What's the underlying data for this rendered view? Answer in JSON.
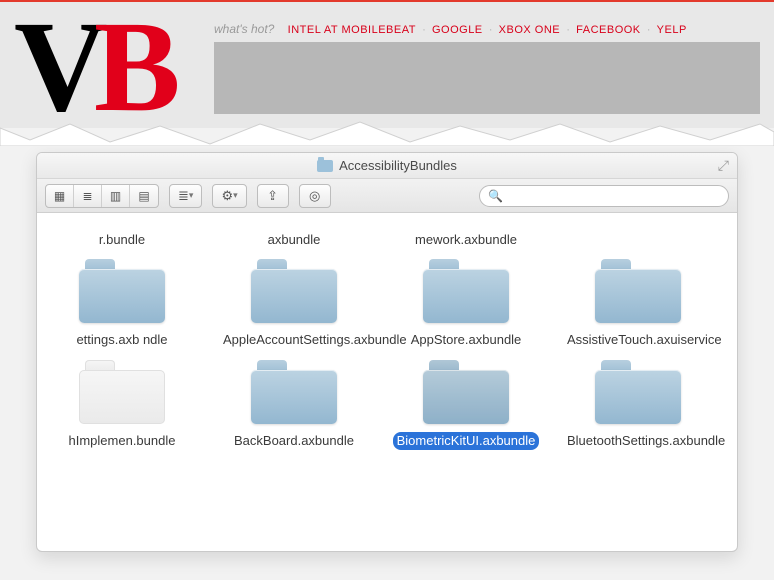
{
  "header": {
    "logo_left": "V",
    "logo_right": "B",
    "lead": "what's hot?",
    "links": [
      "INTEL AT MOBILEBEAT",
      "GOOGLE",
      "XBOX ONE",
      "FACEBOOK",
      "YELP"
    ]
  },
  "finder": {
    "title": "AccessibilityBundles",
    "search_placeholder": "",
    "toolbar": {
      "view_icons": [
        "ico-grid",
        "ico-list",
        "ico-col",
        "ico-cov"
      ]
    },
    "rows": [
      {
        "partial": true,
        "items": [
          {
            "name": "r.bundle",
            "ghost": false
          },
          {
            "name": "axbundle",
            "ghost": false
          },
          {
            "name": "mework.axbundle",
            "ghost": false
          }
        ]
      },
      {
        "partial": false,
        "items": [
          {
            "name": "ettings.axb\nndle",
            "ghost": false
          },
          {
            "name": "AppleAccountSettings.axbundle",
            "ghost": false
          },
          {
            "name": "AppStore.axbundle",
            "ghost": false
          },
          {
            "name": "AssistiveTouch.axuiservice",
            "ghost": false
          }
        ]
      },
      {
        "partial": false,
        "items": [
          {
            "name": "hImplemen.bundle",
            "ghost": true
          },
          {
            "name": "BackBoard.axbundle",
            "ghost": false
          },
          {
            "name": "BiometricKitUI.axbundle",
            "ghost": false,
            "selected": true
          },
          {
            "name": "BluetoothSettings.axbundle",
            "ghost": false
          }
        ]
      }
    ]
  }
}
